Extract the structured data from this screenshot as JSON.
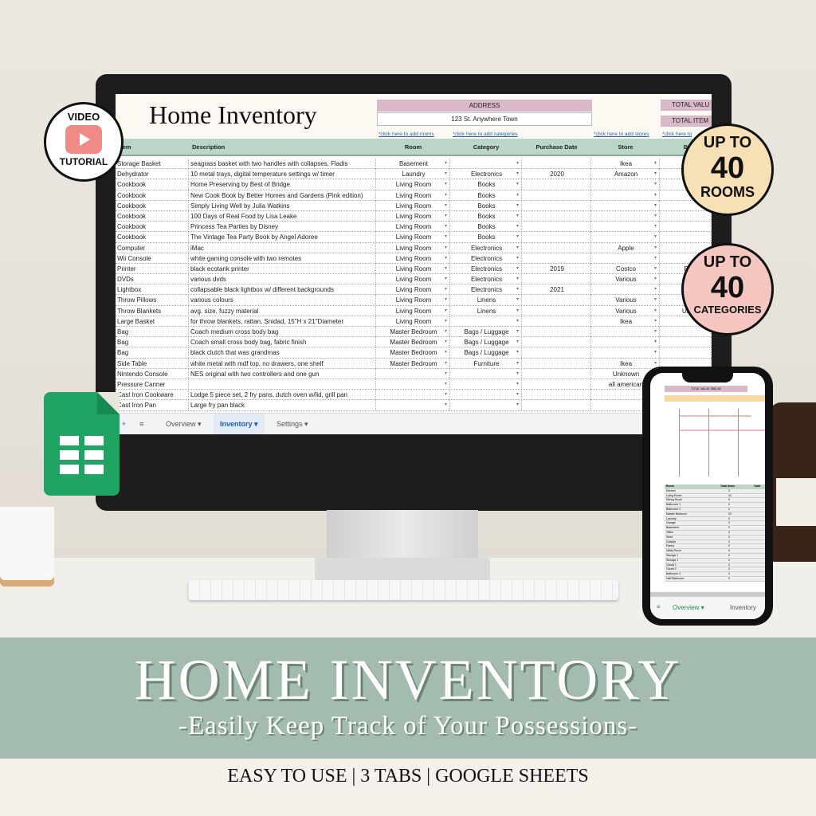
{
  "sheet": {
    "title": "Home Inventory",
    "address_label": "ADDRESS",
    "address_value": "123 St. Anywhere Town",
    "total_value_label": "TOTAL VALU",
    "total_items_label": "TOTAL ITEM",
    "links": [
      "*click here to add rooms",
      "*click here to add categories",
      "*click here to add stores",
      "*click here to"
    ],
    "columns": [
      "Item",
      "Description",
      "Room",
      "Category",
      "Purchase Date",
      "Store",
      "B"
    ],
    "rows": [
      [
        "Storage Basket",
        "seagrass basket with two handles with collapses, Fladis",
        "Basement",
        "",
        "",
        "Ikea",
        ""
      ],
      [
        "Dehydrator",
        "10 metal trays, digital temperature settings w/ timer",
        "Laundry",
        "Electronics",
        "2020",
        "Amazon",
        ""
      ],
      [
        "Cookbook",
        "Home Preserving by Best of Bridge",
        "Living Room",
        "Books",
        "",
        "",
        ""
      ],
      [
        "Cookbook",
        "New Cook Book by Better Homes and Gardens (Pink edition)",
        "Living Room",
        "Books",
        "",
        "",
        ""
      ],
      [
        "Cookbook",
        "Simply Living Well by Julia Watkins",
        "Living Room",
        "Books",
        "",
        "",
        ""
      ],
      [
        "Cookbook",
        "100 Days of Real Food by Lisa Leake",
        "Living Room",
        "Books",
        "",
        "",
        ""
      ],
      [
        "Cookbook",
        "Princess Tea Parties by Disney",
        "Living Room",
        "Books",
        "",
        "",
        ""
      ],
      [
        "Cookbook",
        "The Vintage Tea Party Book by Angel Adoree",
        "Living Room",
        "Books",
        "",
        "",
        ""
      ],
      [
        "Computer",
        "iMac",
        "Living Room",
        "Electronics",
        "",
        "Apple",
        ""
      ],
      [
        "Wii Console",
        "white gaming console with two remotes",
        "Living Room",
        "Electronics",
        "",
        "",
        ""
      ],
      [
        "Printer",
        "black ecotank printer",
        "Living Room",
        "Electronics",
        "2019",
        "Costco",
        "E"
      ],
      [
        "DVDs",
        "various dvds",
        "Living Room",
        "Electronics",
        "",
        "Various",
        "V"
      ],
      [
        "Lightbox",
        "collapsable black lightbox w/ different backgrounds",
        "Living Room",
        "Electronics",
        "2021",
        "",
        ""
      ],
      [
        "Throw Pillows",
        "various colours",
        "Living Room",
        "Linens",
        "",
        "Various",
        "U"
      ],
      [
        "Throw Blankets",
        "avg. size, fuzzy material",
        "Living Room",
        "Linens",
        "",
        "Various",
        "Un"
      ],
      [
        "Large Basket",
        "for throw blankets, rattan, Snidad, 15\"H x 21\"Diameter",
        "Living Room",
        "",
        "",
        "Ikea",
        ""
      ],
      [
        "Bag",
        "Coach medium cross body bag",
        "Master Bedroom",
        "Bags / Luggage",
        "",
        "",
        ""
      ],
      [
        "Bag",
        "Coach small cross body bag, fabric finish",
        "Master Bedroom",
        "Bags / Luggage",
        "",
        "",
        ""
      ],
      [
        "Bag",
        "black clutch that was grandmas",
        "Master Bedroom",
        "Bags / Luggage",
        "",
        "",
        ""
      ],
      [
        "Side Table",
        "white metal with mdf top, no drawers, one shelf",
        "Master Bedroom",
        "Furniture",
        "",
        "Ikea",
        ""
      ],
      [
        "Nintendo Console",
        "NES original with two controllers and one gun",
        "",
        "",
        "",
        "Unknown",
        ""
      ],
      [
        "Pressure Canner",
        "",
        "",
        "",
        "",
        "all american",
        ""
      ],
      [
        "Cast Iron Cookware",
        "Lodge 5 piece set, 2 fry pans, dutch oven w/lid, grill pan",
        "",
        "",
        "",
        "",
        ""
      ],
      [
        "Cast Iron Pan",
        "Large fry pan black",
        "",
        "",
        "",
        "",
        ""
      ]
    ],
    "tabs": {
      "add": "+",
      "menu": "≡",
      "overview": "Overview ▾",
      "inventory": "Inventory ▾",
      "settings": "Settings ▾"
    }
  },
  "badges": {
    "video_top": "VIDEO",
    "video_bottom": "TUTORIAL",
    "rooms_top": "UP TO",
    "rooms_num": "40",
    "rooms_bottom": "ROOMS",
    "cat_top": "UP TO",
    "cat_num": "40",
    "cat_bottom": "CATEGORIES"
  },
  "phone": {
    "total_value": "TOTAL VALUE: $561.82",
    "col_room": "Room",
    "col_items": "Total Items",
    "col_total": "Total",
    "rooms": [
      [
        "Kitchen",
        "0"
      ],
      [
        "Living Room",
        "41"
      ],
      [
        "Dining Room",
        "0"
      ],
      [
        "Bathroom 1",
        "0"
      ],
      [
        "Bathroom 2",
        "0"
      ],
      [
        "Master Bedroom",
        "23"
      ],
      [
        "Laundry",
        "0"
      ],
      [
        "Garage",
        "0"
      ],
      [
        "Basement",
        "0"
      ],
      [
        "Office",
        "0"
      ],
      [
        "Shed",
        "0"
      ],
      [
        "Outside",
        "0"
      ],
      [
        "Pantry",
        "0"
      ],
      [
        "Utility Room",
        "0"
      ],
      [
        "Storage 1",
        "0"
      ],
      [
        "Storage 2",
        "0"
      ],
      [
        "Closet 1",
        "0"
      ],
      [
        "Closet 2",
        "0"
      ],
      [
        "Bathroom 3",
        "0"
      ],
      [
        "Half Bathroom",
        "0"
      ]
    ],
    "tab_overview": "Overview ▾",
    "tab_inventory": "Inventory"
  },
  "banner": {
    "title": "HOME INVENTORY",
    "subtitle": "-Easily Keep Track of Your Possessions-",
    "footer": "EASY TO USE | 3 TABS | GOOGLE SHEETS"
  },
  "colors": {
    "header_green": "#b9d6c6",
    "address_pink": "#d9b9c9",
    "banner_green": "#a4bcaf",
    "rooms_badge": "#f7dfb6",
    "categories_badge": "#f6c6c0",
    "sheets_green": "#1fa463"
  }
}
